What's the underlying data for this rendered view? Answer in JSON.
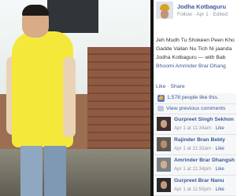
{
  "post": {
    "author": "Jodha Kotbaguru",
    "meta": "Follow · Apr 1 · Edited",
    "caption_lines": [
      "Jeh Mudh Tu Shokeen Peen Kho",
      "Gadde Vailan Nu Tich Ni jaanda",
      "Jodha Kotbaguru — with Bab",
      "Bhoomi Amrinder Brar Dhang"
    ],
    "actions": "Like · Share",
    "likes": "1,578 people like this.",
    "view_previous": "View previous comments"
  },
  "comments": [
    {
      "name": "Gurpreet Singh Sekhon",
      "time": "Apr 1 at 11:34am",
      "like": "Like"
    },
    {
      "name": "Rajinder Bran Bebly",
      "time": "Apr 1 at 11:32am",
      "like": "Like"
    },
    {
      "name": "Amrinder Brar Dhangsh",
      "time": "Apr 1 at 11:34pm",
      "like": "Like"
    },
    {
      "name": "Gurpreet Brar Nanu",
      "time": "Apr 1 at 11:50pm",
      "like": "Like"
    }
  ],
  "colors": {
    "link": "#3b5998",
    "muted": "#90949c",
    "panel_bg": "#f6f7f9",
    "divider": "#141414",
    "shirt": "#f4e93a"
  },
  "icons": [
    "like-thumb-icon",
    "comments-icon"
  ]
}
